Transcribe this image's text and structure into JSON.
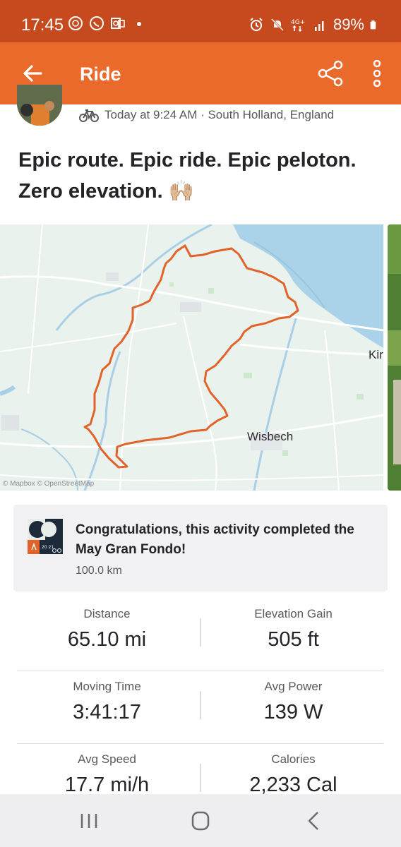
{
  "status_bar": {
    "time": "17:45",
    "battery": "89%",
    "network": "4G+",
    "icons_left": [
      "signal-messenger-icon",
      "whatsapp-icon",
      "outlook-icon",
      "dot-icon"
    ],
    "icons_right": [
      "alarm-icon",
      "mute-icon",
      "network-icon",
      "signal-bars-icon",
      "battery-icon"
    ]
  },
  "app_bar": {
    "title": "Ride",
    "back_icon": "arrow-left-icon",
    "share_icon": "share-icon",
    "more_icon": "more-vertical-icon"
  },
  "activity": {
    "meta": "Today at 9:24 AM · South Holland, England",
    "title": "Epic route. Epic ride. Epic peloton. Zero elevation. 🙌🏼"
  },
  "map": {
    "labels": {
      "town": "Wisbech",
      "town_cut": "Kir"
    },
    "attribution": "© Mapbox © OpenStreetMap"
  },
  "challenge": {
    "title": "Congratulations, this activity completed the May Gran Fondo!",
    "subtitle": "100.0 km",
    "badge_text": "20 21"
  },
  "stats": [
    {
      "left": {
        "label": "Distance",
        "value": "65.10 mi"
      },
      "right": {
        "label": "Elevation Gain",
        "value": "505 ft"
      }
    },
    {
      "left": {
        "label": "Moving Time",
        "value": "3:41:17"
      },
      "right": {
        "label": "Avg Power",
        "value": "139 W"
      }
    },
    {
      "left": {
        "label": "Avg Speed",
        "value": "17.7 mi/h"
      },
      "right": {
        "label": "Calories",
        "value": "2,233 Cal"
      }
    }
  ],
  "colors": {
    "brand_orange": "#ea6a2c",
    "status_bar": "#c74a1e",
    "route": "#e2632a"
  }
}
